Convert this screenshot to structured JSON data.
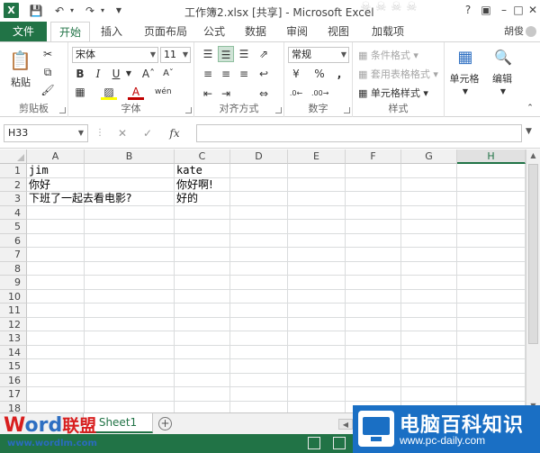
{
  "app": {
    "icon_letter": "X",
    "title": "工作簿2.xlsx  [共享] - Microsoft Excel",
    "user": "胡俊",
    "accent_color": "#217346"
  },
  "tabs": {
    "file": "文件",
    "items": [
      "开始",
      "插入",
      "页面布局",
      "公式",
      "数据",
      "审阅",
      "视图",
      "加载项"
    ],
    "active_index": 0
  },
  "ribbon": {
    "clipboard": {
      "label": "剪贴板",
      "paste": "粘贴"
    },
    "font": {
      "label": "字体",
      "font_name": "宋体",
      "font_size": "11"
    },
    "alignment": {
      "label": "对齐方式"
    },
    "number": {
      "label": "数字",
      "format": "常规"
    },
    "styles": {
      "label": "样式",
      "conditional": "条件格式",
      "table_format": "套用表格格式",
      "cell_styles": "单元格样式"
    },
    "cells": {
      "label": "单元格"
    },
    "editing": {
      "label": "编辑"
    }
  },
  "formula_bar": {
    "name_box": "H33",
    "fx": "fx",
    "content": ""
  },
  "sheet": {
    "columns": [
      "A",
      "B",
      "C",
      "D",
      "E",
      "F",
      "G",
      "H"
    ],
    "selected_column": "H",
    "rows": [
      "1",
      "2",
      "3",
      "4",
      "5",
      "6",
      "7",
      "8",
      "9",
      "10",
      "11",
      "12",
      "13",
      "14",
      "15",
      "16",
      "17",
      "18"
    ],
    "cells": [
      {
        "ref": "A1",
        "value": "jim"
      },
      {
        "ref": "C1",
        "value": "kate"
      },
      {
        "ref": "A2",
        "value": "你好"
      },
      {
        "ref": "C2",
        "value": "你好啊!"
      },
      {
        "ref": "A3",
        "value": "下班了一起去看电影?"
      },
      {
        "ref": "C3",
        "value": "好的"
      }
    ],
    "tab_name": "Sheet1",
    "add_sheet": "+"
  },
  "watermarks": {
    "left_word_w": "W",
    "left_word_o": "ord",
    "left_word_lm": "联盟",
    "left_url": "www.wordlm.com",
    "right_cn": "电脑百科知识",
    "right_en": "www.pc-daily.com"
  }
}
